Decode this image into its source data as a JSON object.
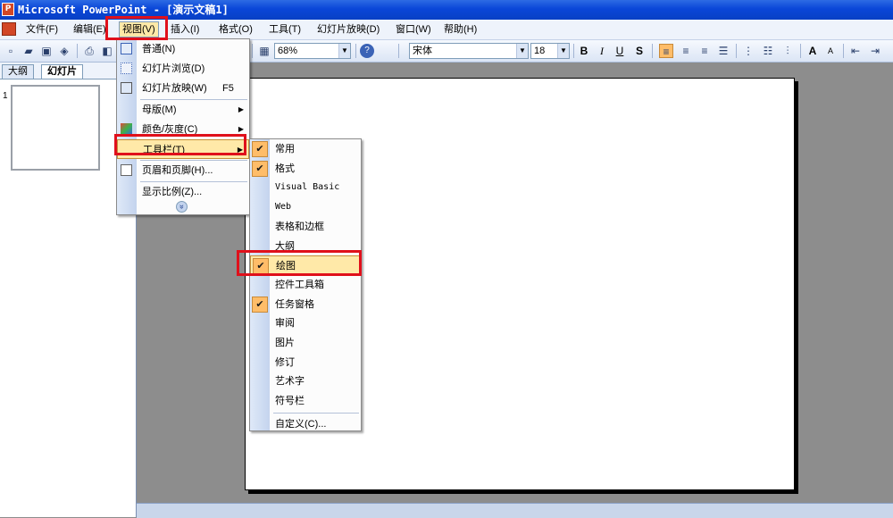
{
  "window": {
    "title": "Microsoft PowerPoint - [演示文稿1]",
    "app_icon": "powerpoint-icon"
  },
  "menubar": {
    "items": [
      {
        "label": "文件(F)"
      },
      {
        "label": "编辑(E)"
      },
      {
        "label": "视图(V)"
      },
      {
        "label": "插入(I)"
      },
      {
        "label": "格式(O)"
      },
      {
        "label": "工具(T)"
      },
      {
        "label": "幻灯片放映(D)"
      },
      {
        "label": "窗口(W)"
      },
      {
        "label": "帮助(H)"
      }
    ],
    "active": "视图(V)"
  },
  "toolbar": {
    "zoom": "68%",
    "font_name": "宋体",
    "font_size": "18",
    "bold": "B",
    "italic": "I",
    "underline": "U",
    "shadow": "S",
    "grow_font": "A",
    "shrink_font": "A",
    "help_glyph": "?"
  },
  "left_pane": {
    "tabs": [
      {
        "label": "大纲"
      },
      {
        "label": "幻灯片"
      }
    ],
    "selected_tab": "幻灯片",
    "slide_number": "1"
  },
  "view_menu": {
    "items": [
      {
        "label": "普通(N)",
        "icon": "normal-view-icon"
      },
      {
        "label": "幻灯片浏览(D)",
        "icon": "slide-sorter-icon"
      },
      {
        "label": "幻灯片放映(W)",
        "shortcut": "F5",
        "icon": "slideshow-icon"
      },
      {
        "label": "母版(M)",
        "submenu": true
      },
      {
        "label": "颜色/灰度(C)",
        "submenu": true,
        "icon": "color-grayscale-icon"
      },
      {
        "label": "工具栏(T)",
        "submenu": true,
        "highlighted": true
      },
      {
        "label": "页眉和页脚(H)...",
        "icon": "header-footer-icon"
      },
      {
        "label": "显示比例(Z)..."
      }
    ],
    "expand_glyph": "»"
  },
  "toolbars_submenu": {
    "items": [
      {
        "label": "常用",
        "checked": true
      },
      {
        "label": "格式",
        "checked": true
      },
      {
        "label": "Visual Basic",
        "checked": false
      },
      {
        "label": "Web",
        "checked": false
      },
      {
        "label": "表格和边框",
        "checked": false
      },
      {
        "label": "大纲",
        "checked": false
      },
      {
        "label": "绘图",
        "checked": true,
        "highlighted": true
      },
      {
        "label": "控件工具箱",
        "checked": false
      },
      {
        "label": "任务窗格",
        "checked": true
      },
      {
        "label": "审阅",
        "checked": false
      },
      {
        "label": "图片",
        "checked": false
      },
      {
        "label": "修订",
        "checked": false
      },
      {
        "label": "艺术字",
        "checked": false
      },
      {
        "label": "符号栏",
        "checked": false
      },
      {
        "label": "自定义(C)...",
        "checked": false
      }
    ],
    "check_glyph": "✔"
  },
  "colors": {
    "title_bar": "#0a46d8",
    "highlight": "#ffe9a8",
    "check_bg": "#ffbd69",
    "annotation_red": "#e0101b",
    "workspace": "#8d8d8d"
  }
}
